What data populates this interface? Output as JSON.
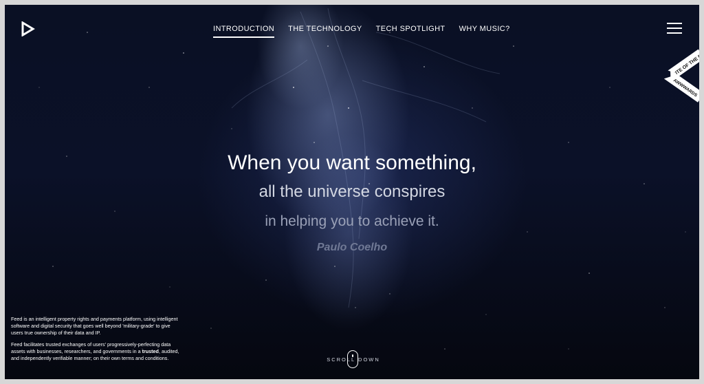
{
  "nav": {
    "items": [
      {
        "label": "INTRODUCTION",
        "active": true
      },
      {
        "label": "THE TECHNOLOGY",
        "active": false
      },
      {
        "label": "TECH SPOTLIGHT",
        "active": false
      },
      {
        "label": "WHY MUSIC?",
        "active": false
      }
    ]
  },
  "icons": {
    "logo": "play-triangle-logo-icon",
    "menu": "hamburger-menu-icon",
    "scroll": "mouse-icon"
  },
  "award": {
    "line1": "SITE OF THE DAY",
    "line2": "AWWWARDS"
  },
  "quote": {
    "line1": "When you want something,",
    "line2": "all the universe conspires",
    "line3": "in helping you to achieve it.",
    "author": "Paulo Coelho"
  },
  "info": {
    "p1": "Feed is an intelligent property rights and payments platform, using intelligent software and digital security that goes well beyond 'military-grade' to give users true ownership of their data and IP.",
    "p2_before": "Feed facilitates trusted exchanges of users' progressively-perfecting data assets with businesses, researchers, and governments in a ",
    "p2_bold": "trusted",
    "p2_after": ", audited, and independently verifiable manner; on their own terms and conditions."
  },
  "scroll": {
    "label": "SCROLL DOWN"
  },
  "colors": {
    "background": "#0a1024",
    "text": "#ffffff",
    "author": "#707995"
  }
}
